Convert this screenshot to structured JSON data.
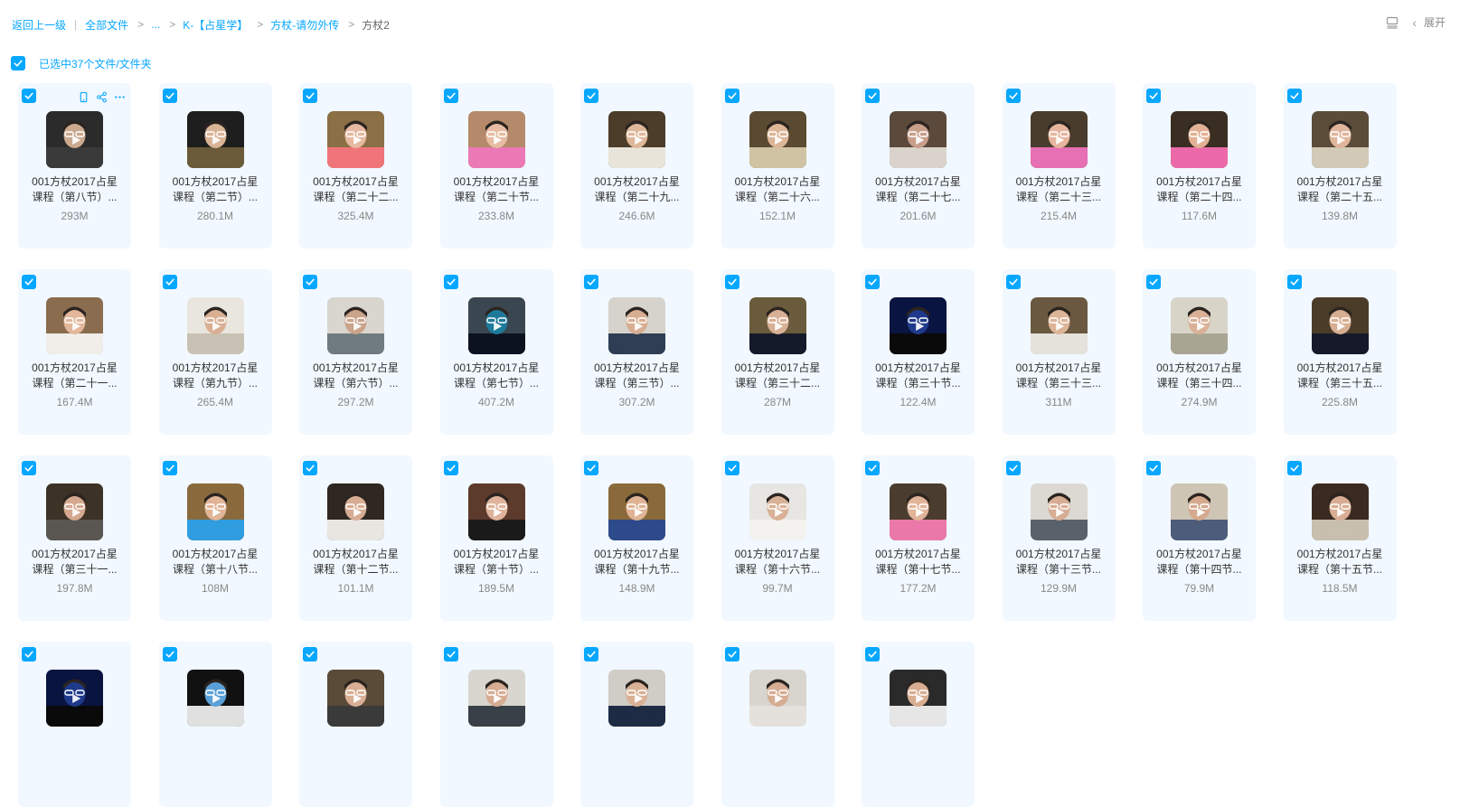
{
  "breadcrumb": {
    "back": "返回上一级",
    "items": [
      "全部文件",
      "...",
      "K-【占星学】",
      "方杖-请勿外传"
    ],
    "current": "方杖2"
  },
  "top_right": {
    "expand_label": "展开",
    "icons": [
      "list-view-icon",
      "chevron-left-icon"
    ]
  },
  "selection": {
    "label": "已选中37个文件/文件夹",
    "checked": true
  },
  "colors": {
    "accent": "#06a7ff",
    "card_bg": "#f1f8ff"
  },
  "files": [
    {
      "line1": "001方杖2017占星",
      "line2": "课程（第八节）...",
      "size": "293M",
      "palette": [
        "#2b2b2b",
        "#caa98e",
        "#3a3a3a"
      ]
    },
    {
      "line1": "001方杖2017占星",
      "line2": "课程（第二节）...",
      "size": "280.1M",
      "palette": [
        "#1e1e1e",
        "#d9b596",
        "#6b5b3a"
      ]
    },
    {
      "line1": "001方杖2017占星",
      "line2": "课程（第二十二...",
      "size": "325.4M",
      "palette": [
        "#8b6f45",
        "#e6b9a0",
        "#f0757a"
      ]
    },
    {
      "line1": "001方杖2017占星",
      "line2": "课程（第二十节...",
      "size": "233.8M",
      "palette": [
        "#b48a6a",
        "#e7bca2",
        "#ea79b6"
      ]
    },
    {
      "line1": "001方杖2017占星",
      "line2": "课程（第二十九...",
      "size": "246.6M",
      "palette": [
        "#4b3d2a",
        "#dfb79b",
        "#e8e4da"
      ]
    },
    {
      "line1": "001方杖2017占星",
      "line2": "课程（第二十六...",
      "size": "152.1M",
      "palette": [
        "#5a4a32",
        "#ddb597",
        "#cfc3a4"
      ]
    },
    {
      "line1": "001方杖2017占星",
      "line2": "课程（第二十七...",
      "size": "201.6M",
      "palette": [
        "#5b4a3c",
        "#c89f8a",
        "#d9d3cb"
      ]
    },
    {
      "line1": "001方杖2017占星",
      "line2": "课程（第二十三...",
      "size": "215.4M",
      "palette": [
        "#4a3c2c",
        "#e6b49e",
        "#e76fb3"
      ]
    },
    {
      "line1": "001方杖2017占星",
      "line2": "课程（第二十四...",
      "size": "117.6M",
      "palette": [
        "#3a2e22",
        "#e2b095",
        "#ec6aa9"
      ]
    },
    {
      "line1": "001方杖2017占星",
      "line2": "课程（第二十五...",
      "size": "139.8M",
      "palette": [
        "#5b4c3a",
        "#dfb59b",
        "#d3c9b7"
      ]
    },
    {
      "line1": "001方杖2017占星",
      "line2": "课程（第二十一...",
      "size": "167.4M",
      "palette": [
        "#8a6c4f",
        "#e3b79b",
        "#f1eee9"
      ]
    },
    {
      "line1": "001方杖2017占星",
      "line2": "课程（第九节）...",
      "size": "265.4M",
      "palette": [
        "#e9e6e0",
        "#d9af93",
        "#c9c2b4"
      ]
    },
    {
      "line1": "001方杖2017占星",
      "line2": "课程（第六节）...",
      "size": "297.2M",
      "palette": [
        "#d9d6d0",
        "#caa38a",
        "#6f7b7e"
      ]
    },
    {
      "line1": "001方杖2017占星",
      "line2": "课程（第七节）...",
      "size": "407.2M",
      "palette": [
        "#3a4650",
        "#1e7a9a",
        "#0c1220"
      ]
    },
    {
      "line1": "001方杖2017占星",
      "line2": "课程（第三节）...",
      "size": "307.2M",
      "palette": [
        "#d6d3cd",
        "#d8ae93",
        "#2f3d55"
      ]
    },
    {
      "line1": "001方杖2017占星",
      "line2": "课程（第三十二...",
      "size": "287M",
      "palette": [
        "#6a5b3c",
        "#d8b095",
        "#141a2a"
      ]
    },
    {
      "line1": "001方杖2017占星",
      "line2": "课程（第三十节...",
      "size": "122.4M",
      "palette": [
        "#0a1440",
        "#1f3a8a",
        "#0a0a0a"
      ]
    },
    {
      "line1": "001方杖2017占星",
      "line2": "课程（第三十三...",
      "size": "311M",
      "palette": [
        "#6a5840",
        "#dcb497",
        "#e5e2dc"
      ]
    },
    {
      "line1": "001方杖2017占星",
      "line2": "课程（第三十四...",
      "size": "274.9M",
      "palette": [
        "#d8d4c8",
        "#d9b196",
        "#a9a593"
      ]
    },
    {
      "line1": "001方杖2017占星",
      "line2": "课程（第三十五...",
      "size": "225.8M",
      "palette": [
        "#4b3c2a",
        "#d8ae92",
        "#15192a"
      ]
    },
    {
      "line1": "001方杖2017占星",
      "line2": "课程（第三十一...",
      "size": "197.8M",
      "palette": [
        "#3d3226",
        "#d4a88e",
        "#5a5753"
      ]
    },
    {
      "line1": "001方杖2017占星",
      "line2": "课程（第十八节...",
      "size": "108M",
      "palette": [
        "#8a6a3d",
        "#e0b496",
        "#2f9de0"
      ]
    },
    {
      "line1": "001方杖2017占星",
      "line2": "课程（第十二节...",
      "size": "101.1M",
      "palette": [
        "#2e2722",
        "#d7ac92",
        "#e9e5e0"
      ]
    },
    {
      "line1": "001方杖2017占星",
      "line2": "课程（第十节）...",
      "size": "189.5M",
      "palette": [
        "#5c3a2c",
        "#dfb39a",
        "#1a1a1a"
      ]
    },
    {
      "line1": "001方杖2017占星",
      "line2": "课程（第十九节...",
      "size": "148.9M",
      "palette": [
        "#8a6a3a",
        "#dfb394",
        "#2d4a8a"
      ]
    },
    {
      "line1": "001方杖2017占星",
      "line2": "课程（第十六节...",
      "size": "99.7M",
      "palette": [
        "#e8e6e2",
        "#d9b196",
        "#f4f2ee"
      ]
    },
    {
      "line1": "001方杖2017占星",
      "line2": "课程（第十七节...",
      "size": "177.2M",
      "palette": [
        "#4a3c2e",
        "#e1b398",
        "#ea78a8"
      ]
    },
    {
      "line1": "001方杖2017占星",
      "line2": "课程（第十三节...",
      "size": "129.9M",
      "palette": [
        "#dcd8d2",
        "#d6ad94",
        "#59616b"
      ]
    },
    {
      "line1": "001方杖2017占星",
      "line2": "课程（第十四节...",
      "size": "79.9M",
      "palette": [
        "#cfc5b4",
        "#d4a98e",
        "#4d5c7a"
      ]
    },
    {
      "line1": "001方杖2017占星",
      "line2": "课程（第十五节...",
      "size": "118.5M",
      "palette": [
        "#3b2a20",
        "#d8ad93",
        "#c9bfae"
      ]
    },
    {
      "line1": "",
      "line2": "",
      "size": "",
      "palette": [
        "#0a1440",
        "#1f3a8a",
        "#0a0a0a"
      ]
    },
    {
      "line1": "",
      "line2": "",
      "size": "",
      "palette": [
        "#111111",
        "#5aa0d8",
        "#e0e0e0"
      ]
    },
    {
      "line1": "",
      "line2": "",
      "size": "",
      "palette": [
        "#5a4a38",
        "#d8ae94",
        "#3a3a3a"
      ]
    },
    {
      "line1": "",
      "line2": "",
      "size": "",
      "palette": [
        "#d9d6d0",
        "#d6ac92",
        "#3a4048"
      ]
    },
    {
      "line1": "",
      "line2": "",
      "size": "",
      "palette": [
        "#d0ccc6",
        "#d9b196",
        "#1e2b44"
      ]
    },
    {
      "line1": "",
      "line2": "",
      "size": "",
      "palette": [
        "#d8d4ce",
        "#d6ad93",
        "#e4e1dc"
      ]
    },
    {
      "line1": "",
      "line2": "",
      "size": "",
      "palette": [
        "#2a2a2a",
        "#d8ae92",
        "#e6e6e6"
      ]
    }
  ]
}
